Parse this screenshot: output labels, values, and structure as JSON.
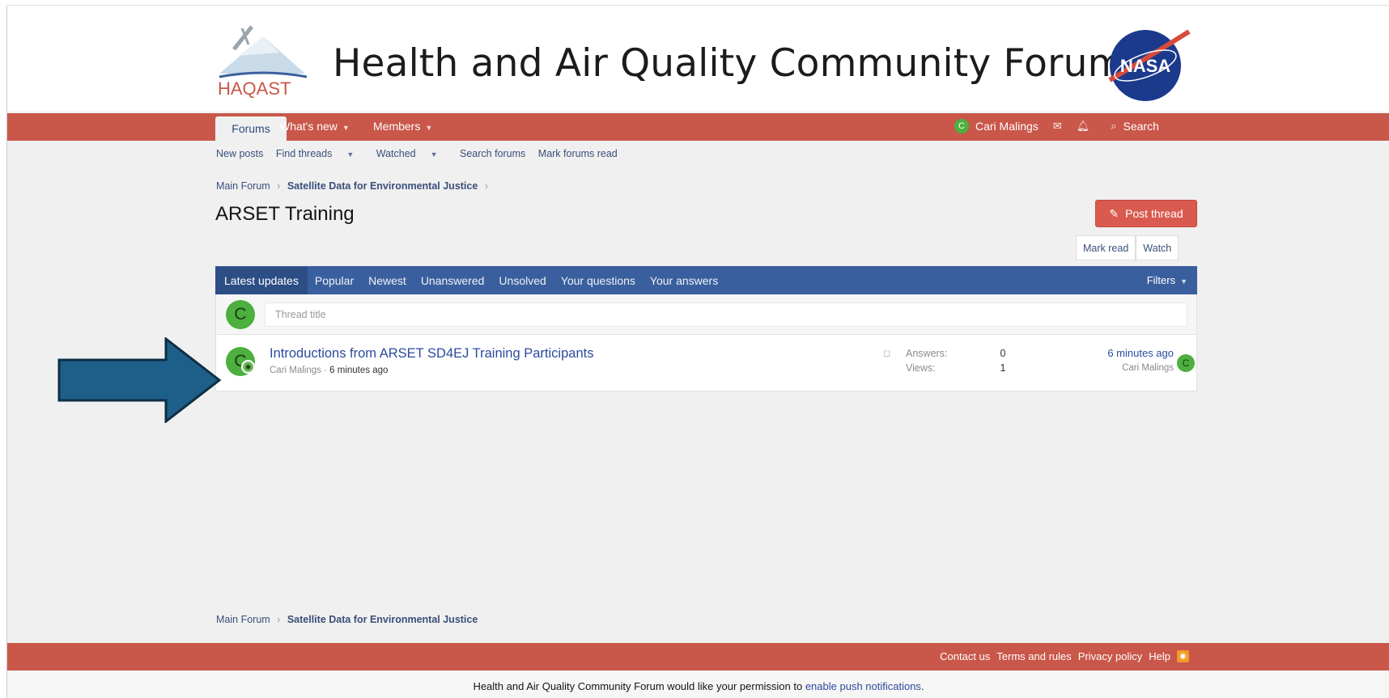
{
  "header": {
    "logo_text": "HAQAST",
    "site_title": "Health and Air Quality Community Forum",
    "nasa_logo_text": "NASA"
  },
  "nav": {
    "tabs": [
      {
        "label": "Forums"
      },
      {
        "label": "What's new"
      },
      {
        "label": "Members"
      }
    ],
    "user_name": "Cari Malings",
    "user_initial": "C",
    "search_label": "Search"
  },
  "subnav": {
    "items": [
      "New posts",
      "Find threads",
      "Watched",
      "Search forums",
      "Mark forums read"
    ]
  },
  "breadcrumb": {
    "items": [
      "Main Forum",
      "Satellite Data for Environmental Justice"
    ]
  },
  "page": {
    "title": "ARSET Training",
    "post_thread_label": "Post thread",
    "mark_read_label": "Mark read",
    "watch_label": "Watch"
  },
  "filter_tabs": {
    "tabs": [
      "Latest updates",
      "Popular",
      "Newest",
      "Unanswered",
      "Unsolved",
      "Your questions",
      "Your answers"
    ],
    "filters_label": "Filters"
  },
  "quick_thread": {
    "avatar_initial": "C",
    "placeholder": "Thread title"
  },
  "threads": [
    {
      "title": "Introductions from ARSET SD4EJ Training Participants",
      "author": "Cari Malings",
      "age": "6 minutes ago",
      "avatar_initial": "C",
      "answers_label": "Answers:",
      "answers": "0",
      "views_label": "Views:",
      "views": "1",
      "latest_time": "6 minutes ago",
      "latest_user": "Cari Malings",
      "latest_initial": "C"
    }
  ],
  "footer": {
    "links": [
      "Contact us",
      "Terms and rules",
      "Privacy policy",
      "Help"
    ]
  },
  "notice": {
    "text_before": "Health and Air Quality Community Forum would like your permission to ",
    "link": "enable push notifications",
    "text_after": "."
  },
  "colors": {
    "nav_red": "#c9574a",
    "filter_blue": "#3a5f9e",
    "avatar_green": "#4caf3e",
    "arrow_blue": "#1e5f8a"
  }
}
